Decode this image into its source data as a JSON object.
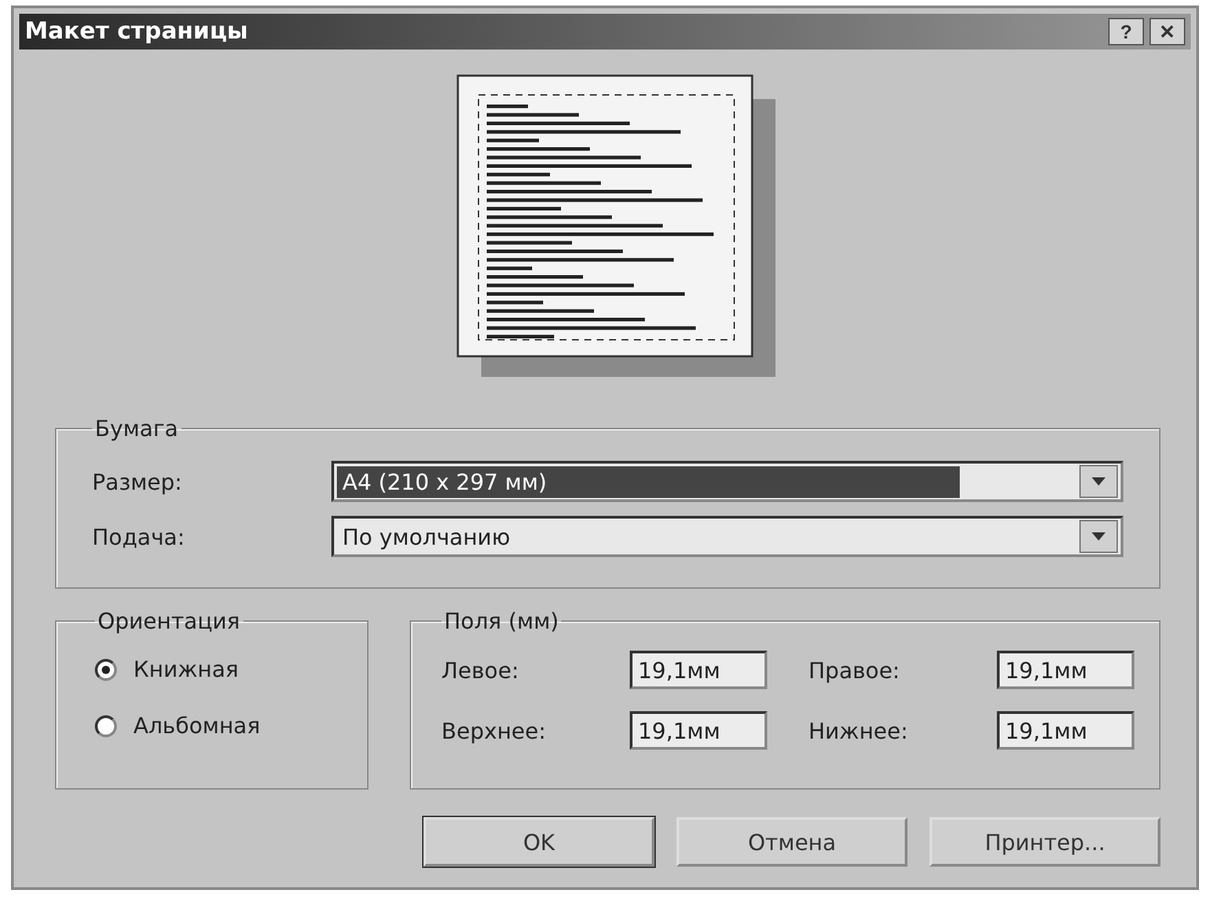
{
  "window": {
    "title": "Макет страницы",
    "buttons": [
      "?",
      "✕"
    ]
  },
  "paper": {
    "title": "Бумага",
    "fields": [
      {
        "label": "Размер:",
        "value": "A4 (210 x 297 мм)",
        "selected": true
      },
      {
        "label": "Подача:",
        "value": "По умолчанию",
        "selected": false
      }
    ]
  },
  "orientation": {
    "title": "Ориентация",
    "options": [
      {
        "label": "Книжная",
        "selected": true
      },
      {
        "label": "Альбомная",
        "selected": false
      }
    ]
  },
  "margins": {
    "title": "Поля (мм)",
    "fields": [
      {
        "label": "Левое:",
        "value": "19,1мм"
      },
      {
        "label": "Правое:",
        "value": "19,1мм"
      },
      {
        "label": "Верхнее:",
        "value": "19,1мм"
      },
      {
        "label": "Нижнее:",
        "value": "19,1мм"
      }
    ]
  },
  "buttons": [
    {
      "label": "OK"
    },
    {
      "label": "Отмена"
    },
    {
      "label": "Принтер..."
    }
  ]
}
